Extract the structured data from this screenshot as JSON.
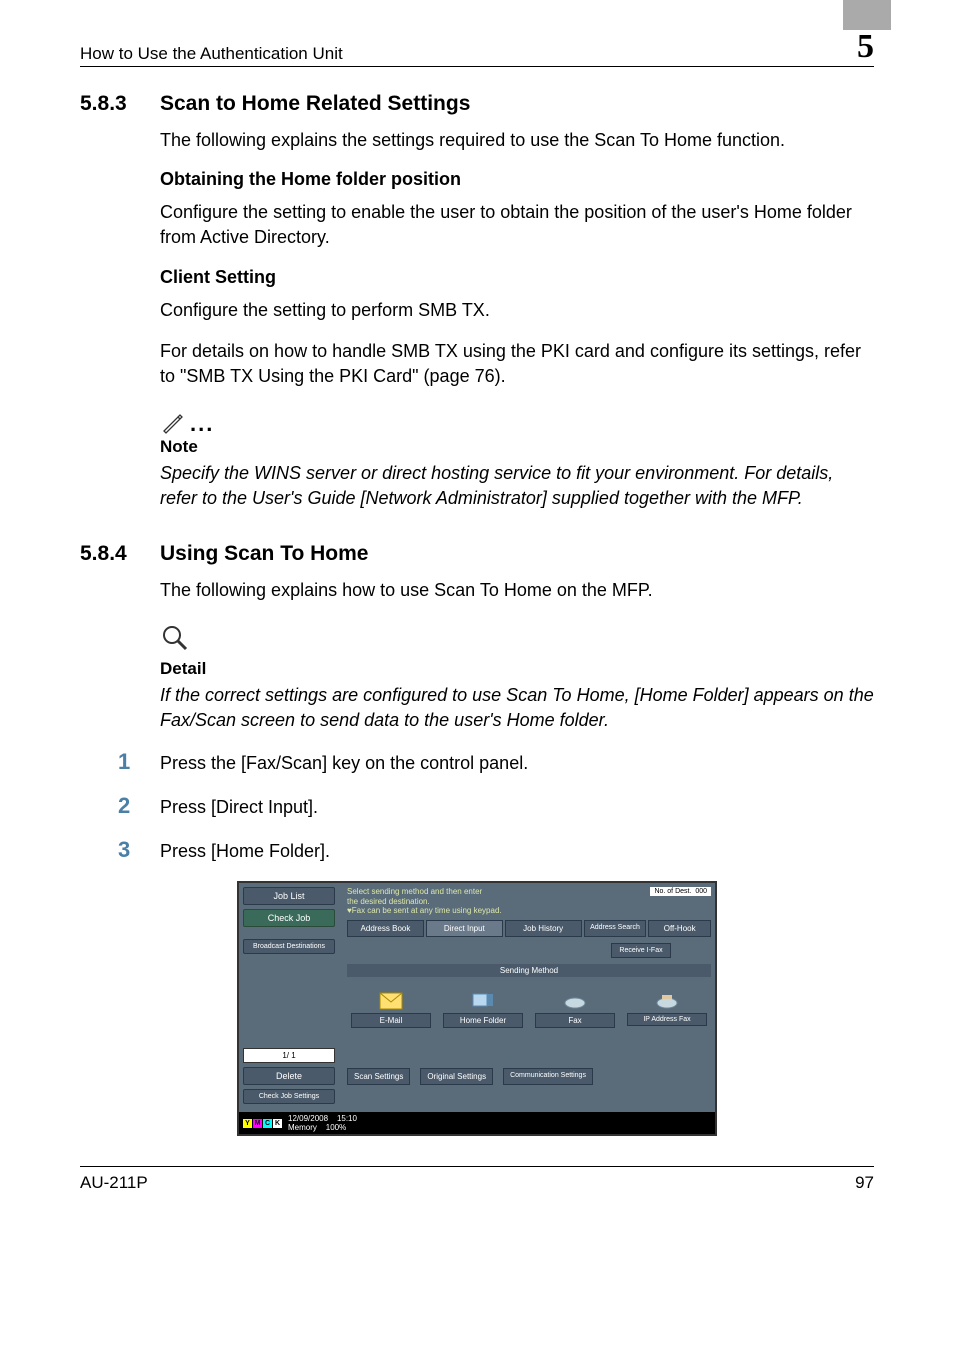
{
  "header": {
    "left": "How to Use the Authentication Unit",
    "chapter": "5"
  },
  "section1": {
    "number": "5.8.3",
    "title": "Scan to Home Related Settings",
    "intro": "The following explains the settings required to use the Scan To Home function.",
    "sub1_title": "Obtaining the Home folder position",
    "sub1_body": "Configure the setting to enable the user to obtain the position of the user's Home folder from Active Directory.",
    "sub2_title": "Client Setting",
    "sub2_body1": "Configure the setting to perform SMB TX.",
    "sub2_body2": "For details on how to handle SMB TX using the PKI card and configure its settings, refer to \"SMB TX Using the PKI Card\" (page 76).",
    "note_label": "Note",
    "note_body": "Specify the WINS server or direct hosting service to fit your environment. For details, refer to the User's Guide [Network Administrator] supplied together with the MFP."
  },
  "section2": {
    "number": "5.8.4",
    "title": "Using Scan To Home",
    "intro": "The following explains how to use Scan To Home on the MFP.",
    "detail_label": "Detail",
    "detail_body": "If the correct settings are configured to use Scan To Home, [Home Folder] appears on the Fax/Scan screen to send data to the user's Home folder.",
    "steps": [
      {
        "num": "1",
        "text": "Press the [Fax/Scan] key on the control panel."
      },
      {
        "num": "2",
        "text": "Press [Direct Input]."
      },
      {
        "num": "3",
        "text": "Press [Home Folder]."
      }
    ]
  },
  "screenshot": {
    "left_buttons": {
      "job_list": "Job List",
      "check_job": "Check Job",
      "broadcast": "Broadcast Destinations",
      "pager": "1/  1",
      "delete": "Delete",
      "check_job_settings": "Check Job Settings"
    },
    "instruction_line1": "Select sending method and then enter",
    "instruction_line2": "the desired destination.",
    "instruction_line3": "♥Fax can be sent at any time using keypad.",
    "dest_count_label": "No. of Dest.",
    "dest_count_value": "000",
    "tabs": {
      "address_book": "Address Book",
      "direct_input": "Direct Input",
      "job_history": "Job History",
      "address_search": "Address Search",
      "off_hook": "Off-Hook"
    },
    "receive_btn": "Receive I-Fax",
    "sending_method_label": "Sending Method",
    "icons": {
      "email": "E-Mail",
      "home_folder": "Home Folder",
      "fax": "Fax",
      "ip_fax": "IP Address Fax"
    },
    "bottom": {
      "scan_settings": "Scan Settings",
      "original_settings": "Original Settings",
      "comm_settings": "Communication Settings"
    },
    "footer": {
      "date": "12/09/2008",
      "time": "15:10",
      "memory_label": "Memory",
      "memory_value": "100%"
    }
  },
  "footer": {
    "left": "AU-211P",
    "right": "97"
  }
}
